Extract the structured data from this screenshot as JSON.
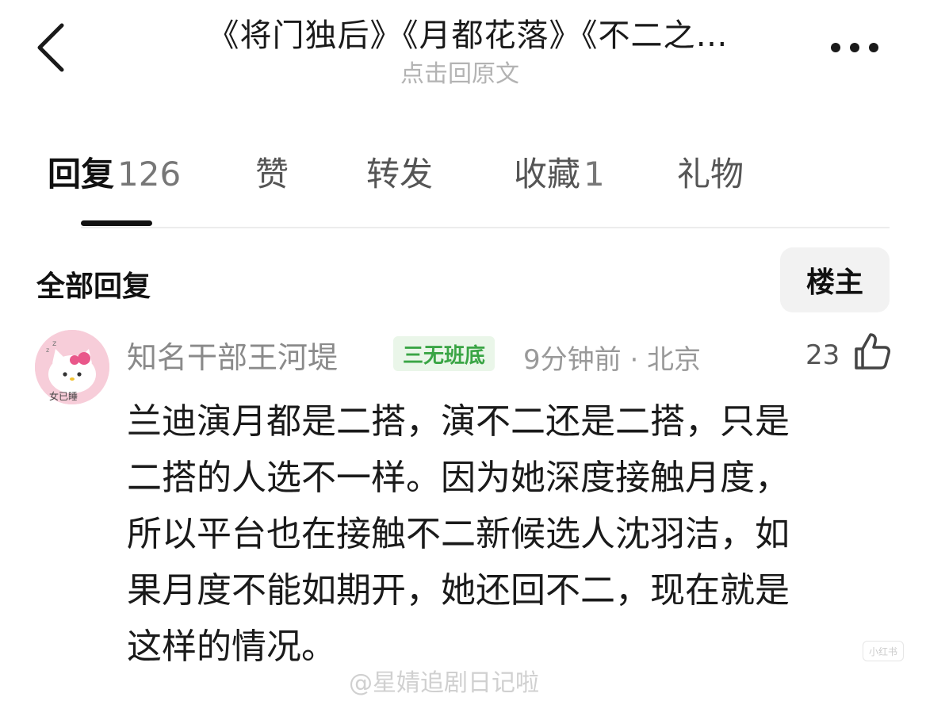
{
  "header": {
    "title": "《将门独后》《月都花落》《不二之…",
    "subtitle": "点击回原文",
    "back_icon": "chevron-left-icon",
    "more_icon": "more-horizontal-icon"
  },
  "tabs": [
    {
      "label": "回复",
      "count": "126",
      "active": true
    },
    {
      "label": "赞",
      "count": "",
      "active": false
    },
    {
      "label": "转发",
      "count": "",
      "active": false
    },
    {
      "label": "收藏",
      "count": "1",
      "active": false
    },
    {
      "label": "礼物",
      "count": "",
      "active": false
    }
  ],
  "section": {
    "title": "全部回复",
    "filter_label": "楼主"
  },
  "comment": {
    "avatar_caption": "女已睡",
    "username": "知名干部王河堤",
    "badge": "三无班底",
    "meta": "9分钟前 · 北京",
    "likes": "23",
    "like_icon": "thumbs-up-icon",
    "text_lines": [
      "兰迪演月都是二搭，演不二还是二搭，只是",
      "二搭的人选不一样。因为她深度接触月度，",
      "所以平台也在接触不二新候选人沈羽洁，如",
      "果月度不能如期开，她还回不二，现在就是",
      "这样的情况。"
    ]
  },
  "watermark": "@星婧追剧日记啦",
  "corner_tag": "小红书",
  "colors": {
    "badge_bg": "#eaf6e9",
    "badge_text": "#3aa545",
    "muted_text": "#999999",
    "avatar_bg": "#f7cdd9"
  }
}
